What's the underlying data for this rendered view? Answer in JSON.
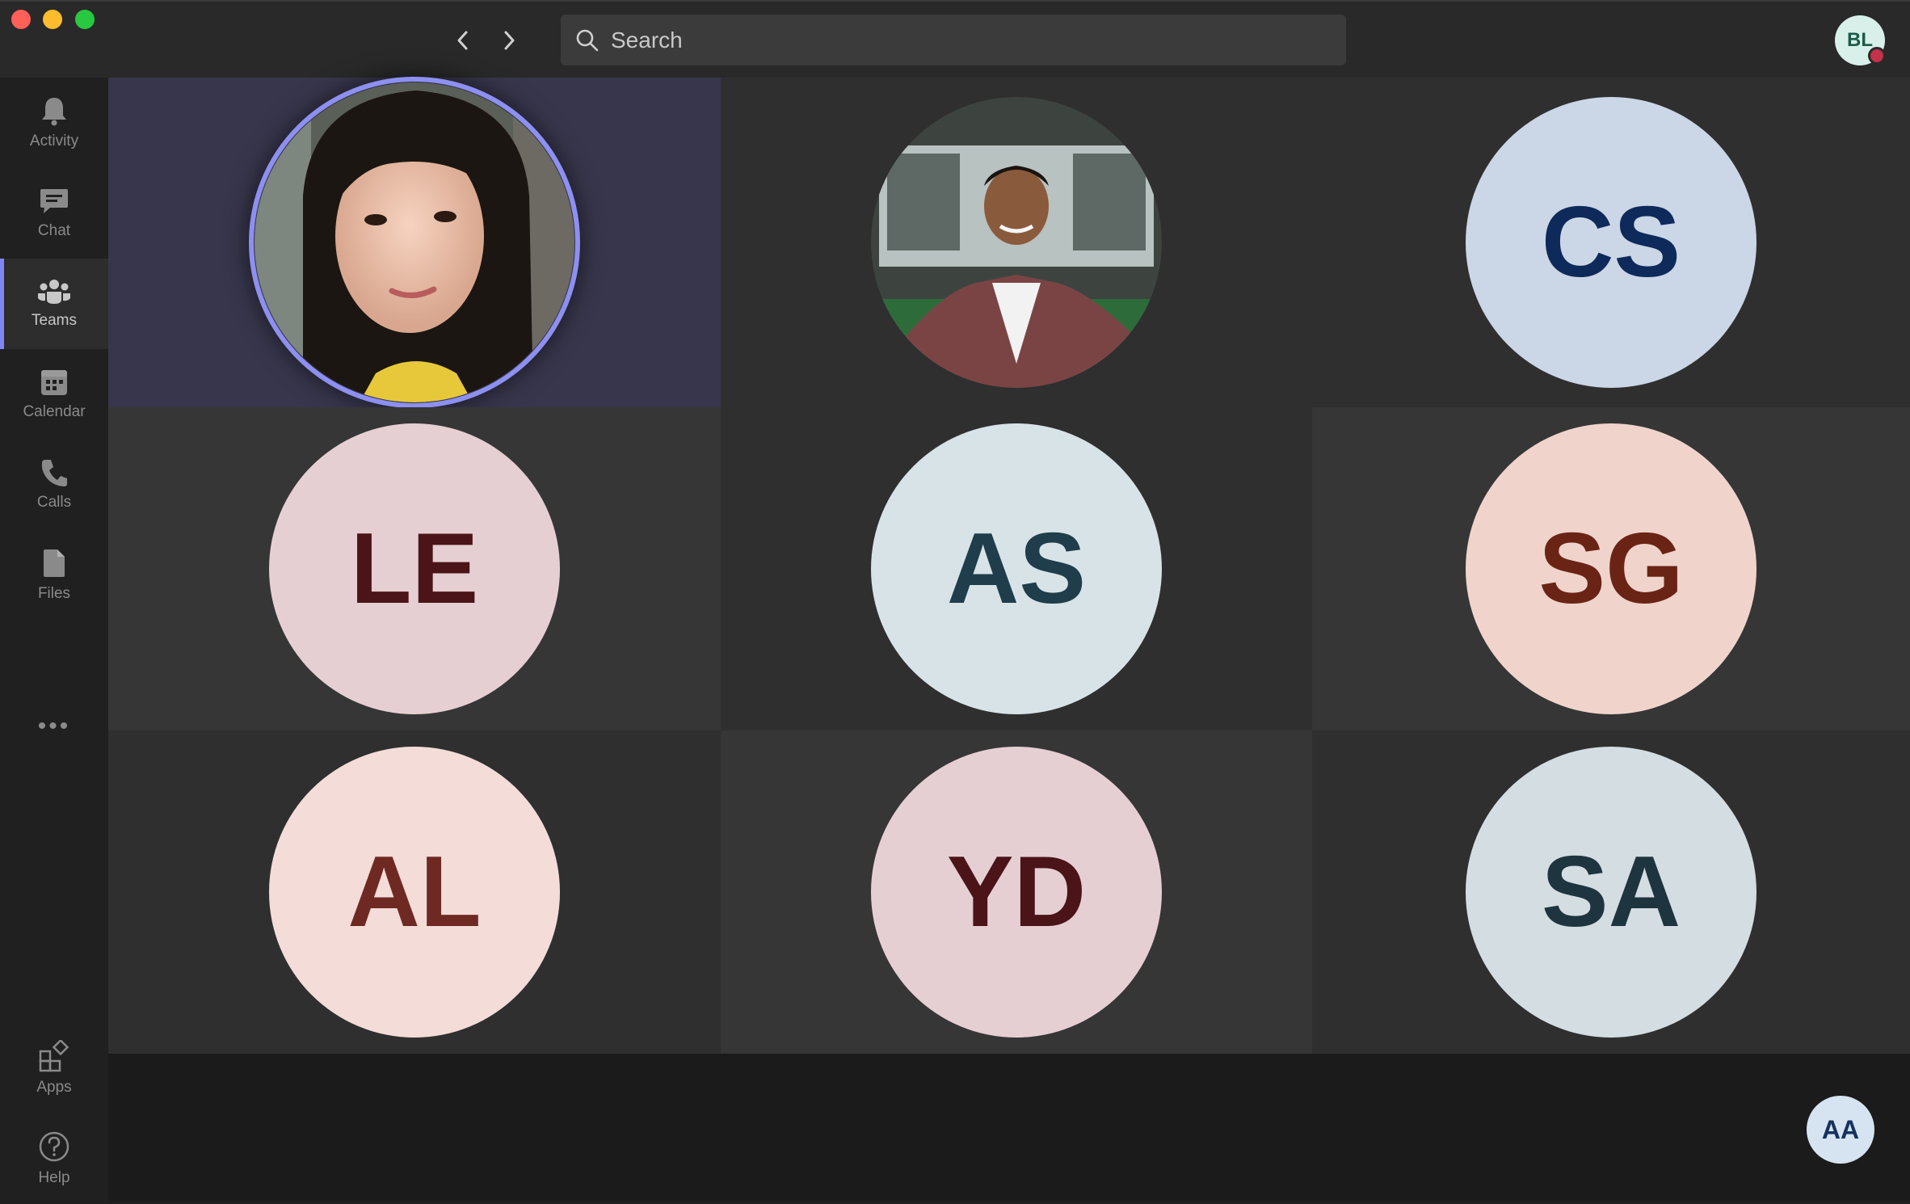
{
  "header": {
    "search_placeholder": "Search",
    "user_initials": "BL",
    "user_status_color": "#c4314b"
  },
  "rail": {
    "items": [
      {
        "label": "Activity",
        "icon": "bell-icon"
      },
      {
        "label": "Chat",
        "icon": "chat-icon"
      },
      {
        "label": "Teams",
        "icon": "teams-icon",
        "active": true
      },
      {
        "label": "Calendar",
        "icon": "calendar-icon"
      },
      {
        "label": "Calls",
        "icon": "phone-icon"
      },
      {
        "label": "Files",
        "icon": "file-icon"
      }
    ],
    "more_label": "•••",
    "bottom_items": [
      {
        "label": "Apps",
        "icon": "apps-icon"
      },
      {
        "label": "Help",
        "icon": "help-icon"
      }
    ]
  },
  "participants": [
    {
      "type": "photo",
      "description": "woman-portrait",
      "speaking": true
    },
    {
      "type": "photo",
      "description": "man-in-suit"
    },
    {
      "initials": "CS",
      "bg": "#cbd6e6",
      "fg": "#0e2a5a"
    },
    {
      "initials": "LE",
      "bg": "#e6cfd2",
      "fg": "#4a1418"
    },
    {
      "initials": "AS",
      "bg": "#d8e3e8",
      "fg": "#1f3d4a"
    },
    {
      "initials": "SG",
      "bg": "#f0d4cc",
      "fg": "#6a2415"
    },
    {
      "initials": "AL",
      "bg": "#f4dcd8",
      "fg": "#6e2a22"
    },
    {
      "initials": "YD",
      "bg": "#e6cfd2",
      "fg": "#4a1418"
    },
    {
      "initials": "SA",
      "bg": "#d4dde2",
      "fg": "#1e3540"
    }
  ],
  "self_view": {
    "initials": "AA"
  },
  "colors": {
    "accent": "#7f85f5",
    "speaking_ring": "#8d90f0"
  }
}
